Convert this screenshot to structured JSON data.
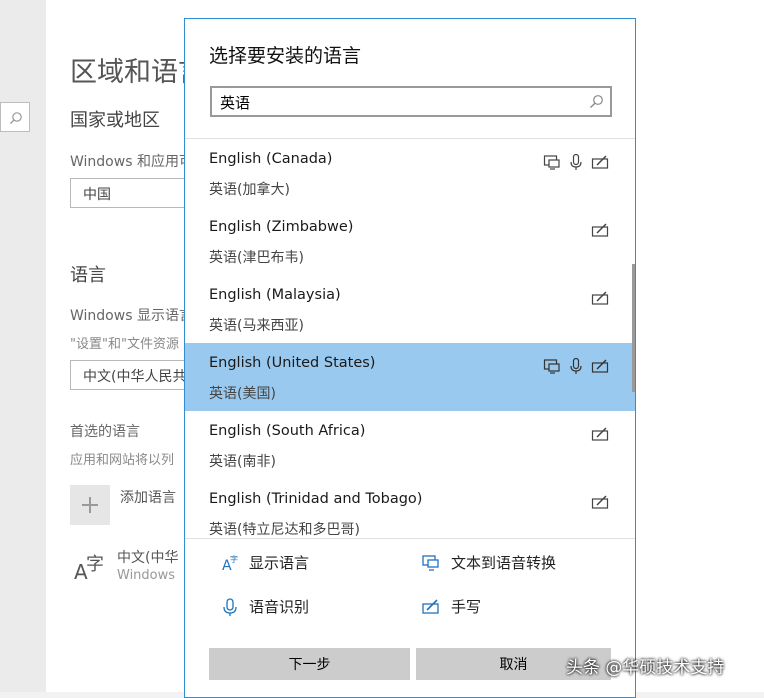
{
  "background": {
    "title": "区域和语言",
    "region_heading": "国家或地区",
    "region_desc": "Windows 和应用可",
    "region_value": "中国",
    "language_heading": "语言",
    "display_lang_desc": "Windows 显示语言",
    "display_lang_desc2": "\"设置\"和\"文件资源",
    "display_lang_value": "中文(中华人民共",
    "preferred_heading": "首选的语言",
    "preferred_desc": "应用和网站将以列",
    "add_language_label": "添加语言",
    "lang_entry_name": "中文(中华",
    "lang_entry_sub": "Windows",
    "lang_icon_glyph": "字",
    "lang_icon_glyph2": "A"
  },
  "dialog": {
    "title": "选择要安装的语言",
    "search_value": "英语",
    "languages": [
      {
        "name": "English (Canada)",
        "native": "英语(加拿大)",
        "features": [
          "display-language",
          "speech",
          "handwriting"
        ],
        "selected": false
      },
      {
        "name": "English (Zimbabwe)",
        "native": "英语(津巴布韦)",
        "features": [
          "handwriting"
        ],
        "selected": false
      },
      {
        "name": "English (Malaysia)",
        "native": "英语(马来西亚)",
        "features": [
          "handwriting"
        ],
        "selected": false
      },
      {
        "name": "English (United States)",
        "native": "英语(美国)",
        "features": [
          "display-language",
          "speech",
          "handwriting"
        ],
        "selected": true
      },
      {
        "name": "English (South Africa)",
        "native": "英语(南非)",
        "features": [
          "handwriting"
        ],
        "selected": false
      },
      {
        "name": "English (Trinidad and Tobago)",
        "native": "英语(特立尼达和多巴哥)",
        "features": [
          "handwriting"
        ],
        "selected": false
      }
    ],
    "legend": {
      "display_language": "显示语言",
      "text_to_speech": "文本到语音转换",
      "speech_recognition": "语音识别",
      "handwriting": "手写"
    },
    "next_button": "下一步",
    "cancel_button": "取消"
  },
  "watermark": "头条 @华硕技术支持",
  "colors": {
    "selected_row": "#99c9ee",
    "dialog_border": "#2f8fd0",
    "icon_blue": "#1e73be",
    "button_bg": "#cccccc"
  }
}
